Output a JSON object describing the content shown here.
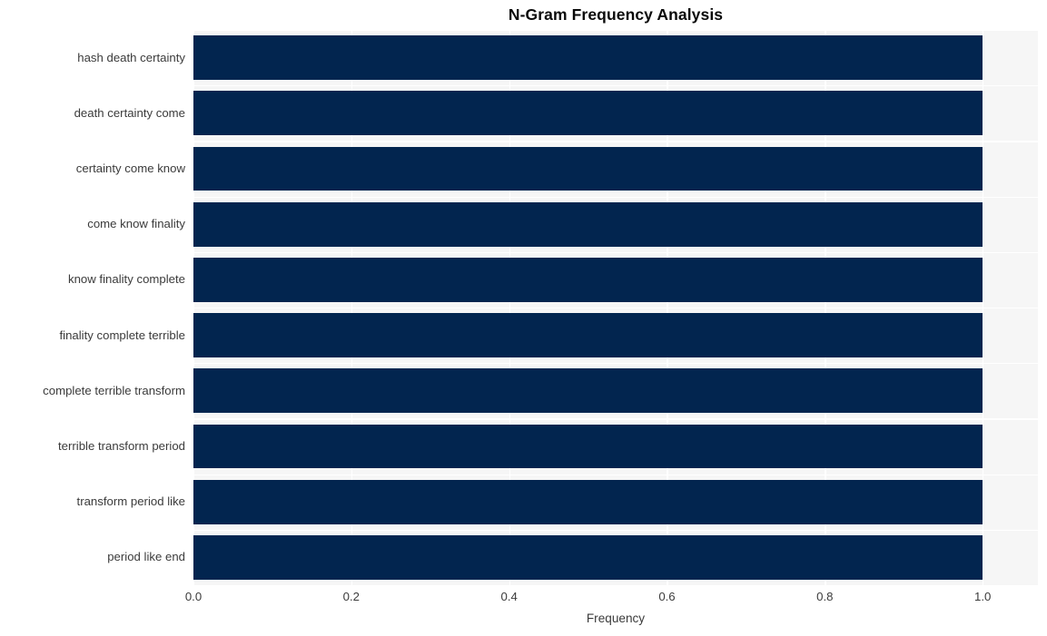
{
  "chart_data": {
    "type": "bar",
    "orientation": "horizontal",
    "title": "N-Gram Frequency Analysis",
    "xlabel": "Frequency",
    "ylabel": "",
    "categories": [
      "hash death certainty",
      "death certainty come",
      "certainty come know",
      "come know finality",
      "know finality complete",
      "finality complete terrible",
      "complete terrible transform",
      "terrible transform period",
      "transform period like",
      "period like end"
    ],
    "values": [
      1.0,
      1.0,
      1.0,
      1.0,
      1.0,
      1.0,
      1.0,
      1.0,
      1.0,
      1.0
    ],
    "xlim": [
      0.0,
      1.07
    ],
    "xticks": [
      "0.0",
      "0.2",
      "0.4",
      "0.6",
      "0.8",
      "1.0"
    ],
    "xtick_values": [
      0.0,
      0.2,
      0.4,
      0.6,
      0.8,
      1.0
    ],
    "grid": true,
    "legend": false,
    "bar_color": "#02254f",
    "plot_background": "#f6f6f6",
    "grid_color": "#ffffff",
    "figure_background": "#ffffff",
    "tick_label_color": "#3b3b3b",
    "title_color": "#0a0a0a"
  }
}
